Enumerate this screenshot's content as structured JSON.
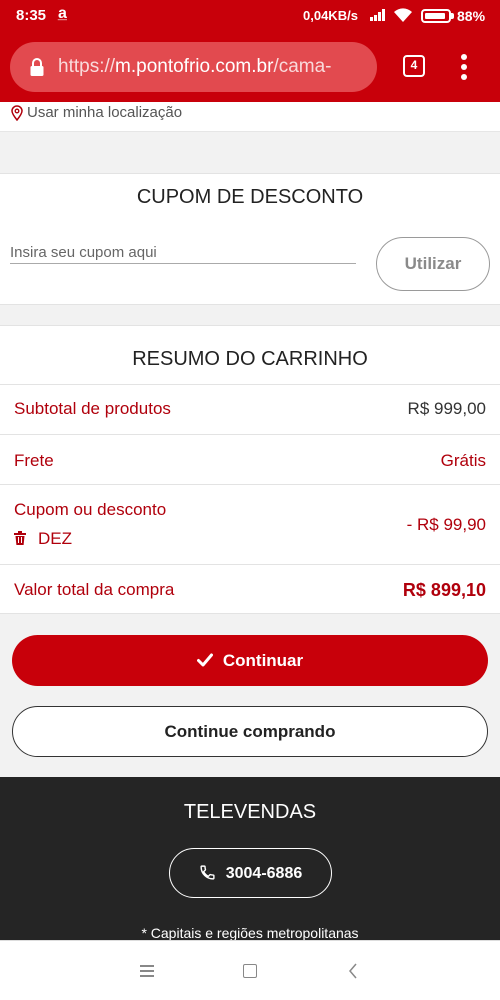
{
  "status_bar": {
    "time": "8:35",
    "notification_glyph": "a̲",
    "network_speed": "0,04KB/s",
    "battery": "88%"
  },
  "browser": {
    "url_prefix": "https://",
    "url_host": "m.pontofrio.com.br",
    "url_path": "/cama-",
    "tab_count": "4"
  },
  "location": {
    "label": "Usar minha localização"
  },
  "coupon": {
    "title": "CUPOM DE DESCONTO",
    "placeholder": "Insira seu cupom aqui",
    "button_label": "Utilizar"
  },
  "summary": {
    "title": "RESUMO DO CARRINHO",
    "subtotal_label": "Subtotal de produtos",
    "subtotal_value": "R$ 999,00",
    "shipping_label": "Frete",
    "shipping_value": "Grátis",
    "discount_label": "Cupom ou desconto",
    "coupon_code": "DEZ",
    "discount_value": "- R$ 99,90",
    "total_label": "Valor total da compra",
    "total_value": "R$ 899,10"
  },
  "actions": {
    "continue_label": "Continuar",
    "keep_shopping_label": "Continue comprando"
  },
  "footer": {
    "title": "TELEVENDAS",
    "phone": "3004-6886",
    "note": "* Capitais e regiões metropolitanas"
  },
  "colors": {
    "brand_red": "#c8000a",
    "text_red": "#b0000c",
    "footer_bg": "#252525"
  },
  "icons": [
    "lock-icon",
    "tabs-icon",
    "more-menu-icon",
    "location-pin-icon",
    "trash-icon",
    "check-icon",
    "phone-icon",
    "nav-menu-icon",
    "nav-home-icon",
    "nav-back-icon"
  ]
}
